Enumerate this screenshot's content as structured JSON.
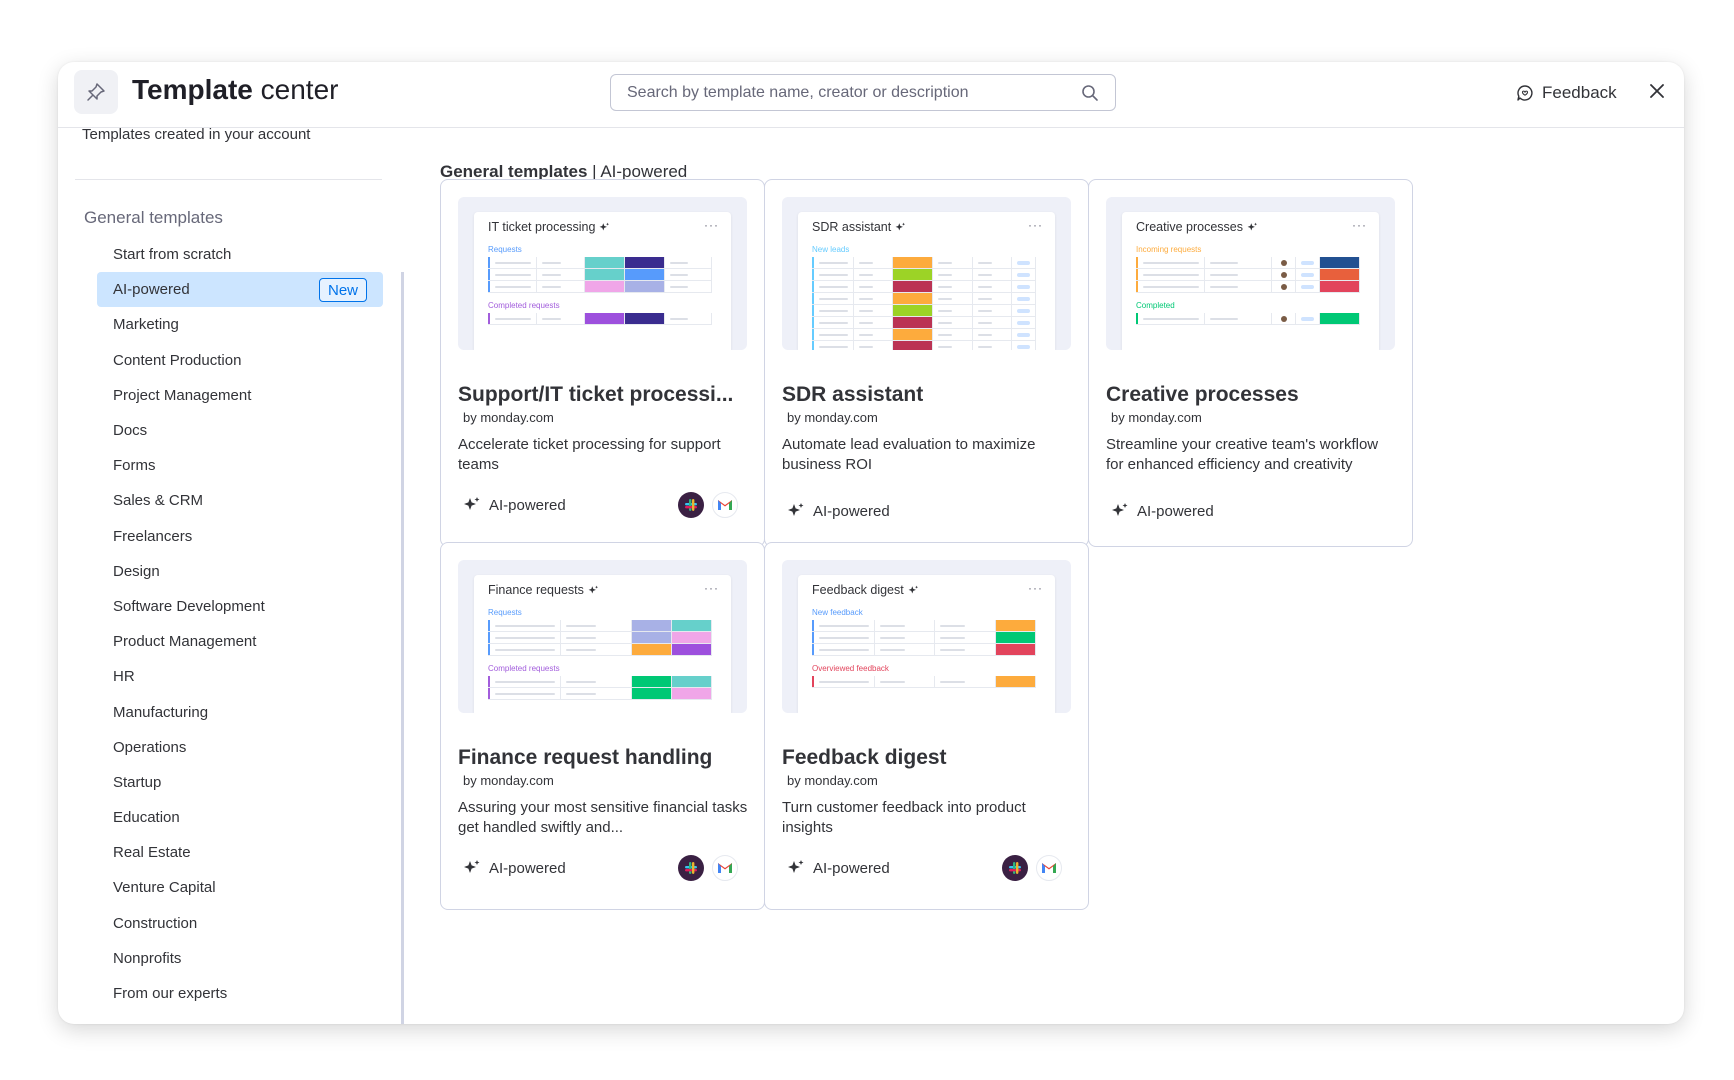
{
  "header": {
    "title_bold": "Template",
    "title_light": " center",
    "search_placeholder": "Search by template name, creator or description",
    "feedback_label": "Feedback"
  },
  "sidebar": {
    "account_link": "Templates created in your account",
    "section_title": "General templates",
    "new_badge": "New",
    "items": [
      {
        "label": "Start from scratch"
      },
      {
        "label": "AI-powered",
        "active": true
      },
      {
        "label": "Marketing"
      },
      {
        "label": "Content Production"
      },
      {
        "label": "Project Management"
      },
      {
        "label": "Docs"
      },
      {
        "label": "Forms"
      },
      {
        "label": "Sales & CRM"
      },
      {
        "label": "Freelancers"
      },
      {
        "label": "Design"
      },
      {
        "label": "Software Development"
      },
      {
        "label": "Product Management"
      },
      {
        "label": "HR"
      },
      {
        "label": "Manufacturing"
      },
      {
        "label": "Operations"
      },
      {
        "label": "Startup"
      },
      {
        "label": "Education"
      },
      {
        "label": "Real Estate"
      },
      {
        "label": "Venture Capital"
      },
      {
        "label": "Construction"
      },
      {
        "label": "Nonprofits"
      },
      {
        "label": "From our experts"
      }
    ]
  },
  "main": {
    "section_title_bold": "General templates",
    "section_title_rest": " | AI-powered",
    "cards": [
      {
        "preview_title": "IT ticket processing",
        "group1": "Requests",
        "group1_color": "#579bfc",
        "group2": "Completed requests",
        "group2_color": "#a25ddc",
        "name": "Support/IT ticket processi...",
        "by": "by monday.com",
        "desc": "Accelerate ticket processing for support teams",
        "tag": "AI-powered",
        "integrations": true
      },
      {
        "preview_title": "SDR assistant",
        "group1": "New leads",
        "group1_color": "#66ccff",
        "group2": "",
        "group2_color": "#66ccff",
        "name": "SDR assistant",
        "by": "by monday.com",
        "desc": "Automate lead evaluation to maximize business ROI",
        "tag": "AI-powered",
        "integrations": false
      },
      {
        "preview_title": "Creative processes",
        "group1": "Incoming requests",
        "group1_color": "#fdab3d",
        "group2": "Completed",
        "group2_color": "#00c875",
        "name": "Creative processes",
        "by": "by monday.com",
        "desc": "Streamline your creative team's workflow for enhanced efficiency and creativity",
        "tag": "AI-powered",
        "integrations": false
      },
      {
        "preview_title": "Finance requests",
        "group1": "Requests",
        "group1_color": "#579bfc",
        "group2": "Completed requests",
        "group2_color": "#a25ddc",
        "name": "Finance request handling",
        "by": "by monday.com",
        "desc": "Assuring your most sensitive financial tasks get handled swiftly and...",
        "tag": "AI-powered",
        "integrations": true
      },
      {
        "preview_title": "Feedback digest",
        "group1": "New feedback",
        "group1_color": "#579bfc",
        "group2": "Overviewed feedback",
        "group2_color": "#e2445c",
        "name": "Feedback digest",
        "by": "by monday.com",
        "desc": "Turn customer feedback into product insights",
        "tag": "AI-powered",
        "integrations": true
      }
    ]
  },
  "colors": {
    "accent": "#0073ea",
    "active_bg": "#cce5ff",
    "border": "#d0d4e4"
  }
}
